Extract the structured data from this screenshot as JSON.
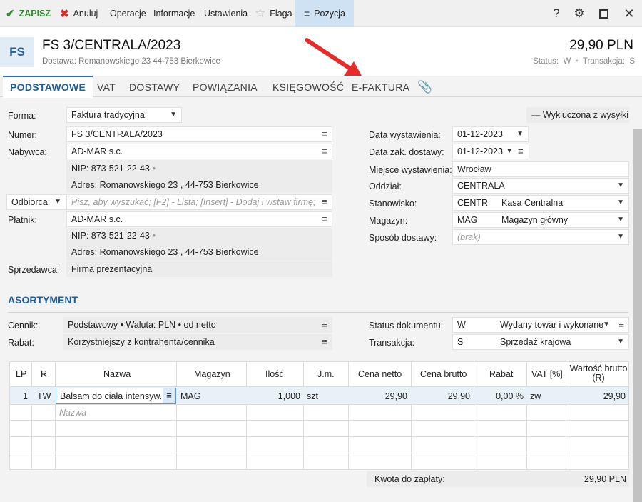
{
  "toolbar": {
    "save": "ZAPISZ",
    "cancel": "Anuluj",
    "operations": "Operacje",
    "info": "Informacje",
    "settings": "Ustawienia",
    "flag": "Flaga",
    "position": "Pozycja"
  },
  "header": {
    "icon_text": "FS",
    "title": "FS 3/CENTRALA/2023",
    "delivery": "Dostawa: Romanowskiego 23  44-753 Bierkowice",
    "amount": "29,90 PLN",
    "status_label": "Status:",
    "status_value": "W",
    "transaction_label": "Transakcja:",
    "transaction_value": "S"
  },
  "tabs": [
    "PODSTAWOWE",
    "VAT",
    "DOSTAWY",
    "POWIĄZANIA",
    "KSIĘGOWOŚĆ",
    "E-FAKTURA"
  ],
  "form": {
    "forma_label": "Forma:",
    "forma_value": "Faktura tradycyjna",
    "excluded": "Wykluczona z wysyłki",
    "numer_label": "Numer:",
    "numer_value": "FS 3/CENTRALA/2023",
    "nabywca_label": "Nabywca:",
    "nabywca_value": "AD-MAR s.c.",
    "nabywca_nip": "NIP:  873-521-22-43",
    "nabywca_adres": "Adres:  Romanowskiego 23 , 44-753 Bierkowice",
    "odbiorca_label": "Odbiorca:",
    "odbiorca_placeholder": "Pisz, aby wyszukać; [F2] - Lista; [Insert] - Dodaj i wstaw firmę;",
    "platnik_label": "Płatnik:",
    "platnik_value": "AD-MAR s.c.",
    "platnik_nip": "NIP:  873-521-22-43",
    "platnik_adres": "Adres:  Romanowskiego 23 , 44-753 Bierkowice",
    "sprzedawca_label": "Sprzedawca:",
    "sprzedawca_value": "Firma prezentacyjna",
    "data_wyst_label": "Data wystawienia:",
    "data_wyst_value": "01-12-2023",
    "data_dost_label": "Data zak. dostawy:",
    "data_dost_value": "01-12-2023",
    "miejsce_label": "Miejsce wystawienia:",
    "miejsce_value": "Wrocław",
    "oddzial_label": "Oddział:",
    "oddzial_value": "CENTRALA",
    "stanowisko_label": "Stanowisko:",
    "stanowisko_code": "CENTR",
    "stanowisko_name": "Kasa Centralna",
    "magazyn_label": "Magazyn:",
    "magazyn_code": "MAG",
    "magazyn_name": "Magazyn główny",
    "sposob_label": "Sposób dostawy:",
    "sposob_value": "(brak)"
  },
  "assortment": {
    "title": "ASORTYMENT",
    "cennik_label": "Cennik:",
    "cennik_value": "Podstawowy • Waluta: PLN • od netto",
    "rabat_label": "Rabat:",
    "rabat_value": "Korzystniejszy z kontrahenta/cennika",
    "status_label": "Status dokumentu:",
    "status_code": "W",
    "status_name": "Wydany towar i wykonane",
    "trans_label": "Transakcja:",
    "trans_code": "S",
    "trans_name": "Sprzedaż krajowa"
  },
  "table": {
    "headers": [
      "LP",
      "R",
      "Nazwa",
      "Magazyn",
      "Ilość",
      "J.m.",
      "Cena netto",
      "Cena brutto",
      "Rabat",
      "VAT [%]",
      "Wartość brutto",
      "(R)"
    ],
    "row": [
      "1",
      "TW",
      "Balsam do ciała intensyw...",
      "MAG",
      "1,000",
      "szt",
      "29,90",
      "29,90",
      "0,00 %",
      "zw",
      "29,90"
    ],
    "name_placeholder": "Nazwa",
    "sum_label": "Kwota do zapłaty:",
    "sum_value": "29,90 PLN"
  },
  "colors": {
    "accent": "#1d5f9a",
    "save": "#2f8a2f",
    "cancel": "#d32f2f",
    "arrow": "#e52b2b"
  }
}
